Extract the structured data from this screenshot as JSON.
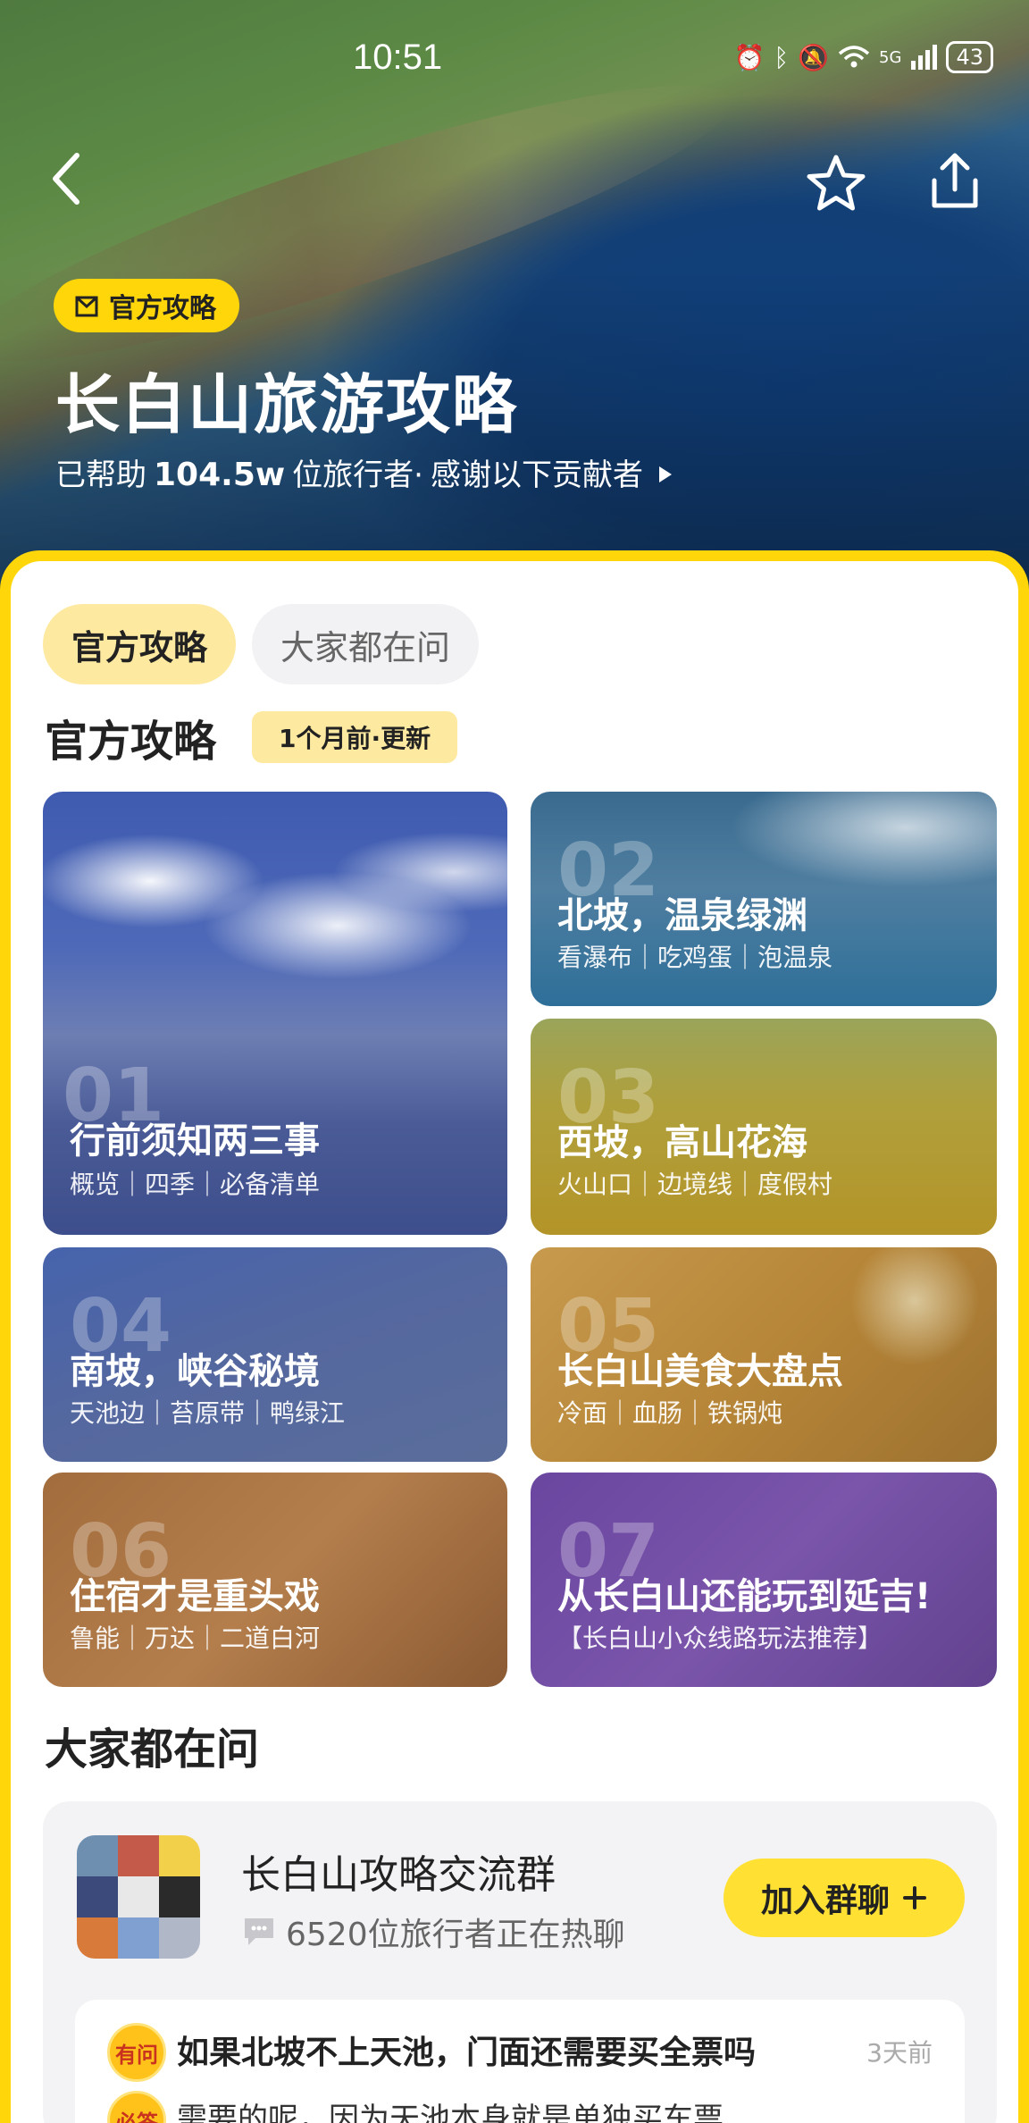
{
  "status": {
    "time": "10:51",
    "network": "5G",
    "battery": "43"
  },
  "hero": {
    "badge": "官方攻略",
    "title": "长白山旅游攻略",
    "helped_prefix": "已帮助",
    "helped_count": "104.5w",
    "helped_suffix": "位旅行者·",
    "thanks": "感谢以下贡献者"
  },
  "tabs": [
    {
      "label": "官方攻略",
      "active": true
    },
    {
      "label": "大家都在问",
      "active": false
    }
  ],
  "guide_section": {
    "title": "官方攻略",
    "updated": "1个月前·更新"
  },
  "guides": [
    {
      "num": "01",
      "title": "行前须知两三事",
      "subtitle": "概览｜四季｜必备清单"
    },
    {
      "num": "02",
      "title": "北坡，温泉绿渊",
      "subtitle": "看瀑布｜吃鸡蛋｜泡温泉"
    },
    {
      "num": "03",
      "title": "西坡，高山花海",
      "subtitle": "火山口｜边境线｜度假村"
    },
    {
      "num": "04",
      "title": "南坡，峡谷秘境",
      "subtitle": "天池边｜苔原带｜鸭绿江"
    },
    {
      "num": "05",
      "title": "长白山美食大盘点",
      "subtitle": "冷面｜血肠｜铁锅炖"
    },
    {
      "num": "06",
      "title": "住宿才是重头戏",
      "subtitle": "鲁能｜万达｜二道白河"
    },
    {
      "num": "07",
      "title": "从长白山还能玩到延吉!",
      "subtitle": "【长白山小众线路玩法推荐】"
    }
  ],
  "ask_section": {
    "title": "大家都在问"
  },
  "group": {
    "name": "长白山攻略交流群",
    "count": "6520位旅行者正在热聊",
    "join_label": "加入群聊",
    "join_icon": "plus-icon"
  },
  "qa": {
    "q_badge": "有问",
    "question": "如果北坡不上天池，门面还需要买全票吗",
    "time": "3天前",
    "a_badge": "必答",
    "answer": "需要的呢，因为天池本身就是单独买车票"
  },
  "colors": {
    "accent": "#ffd60a",
    "pill": "#fde9a0"
  }
}
